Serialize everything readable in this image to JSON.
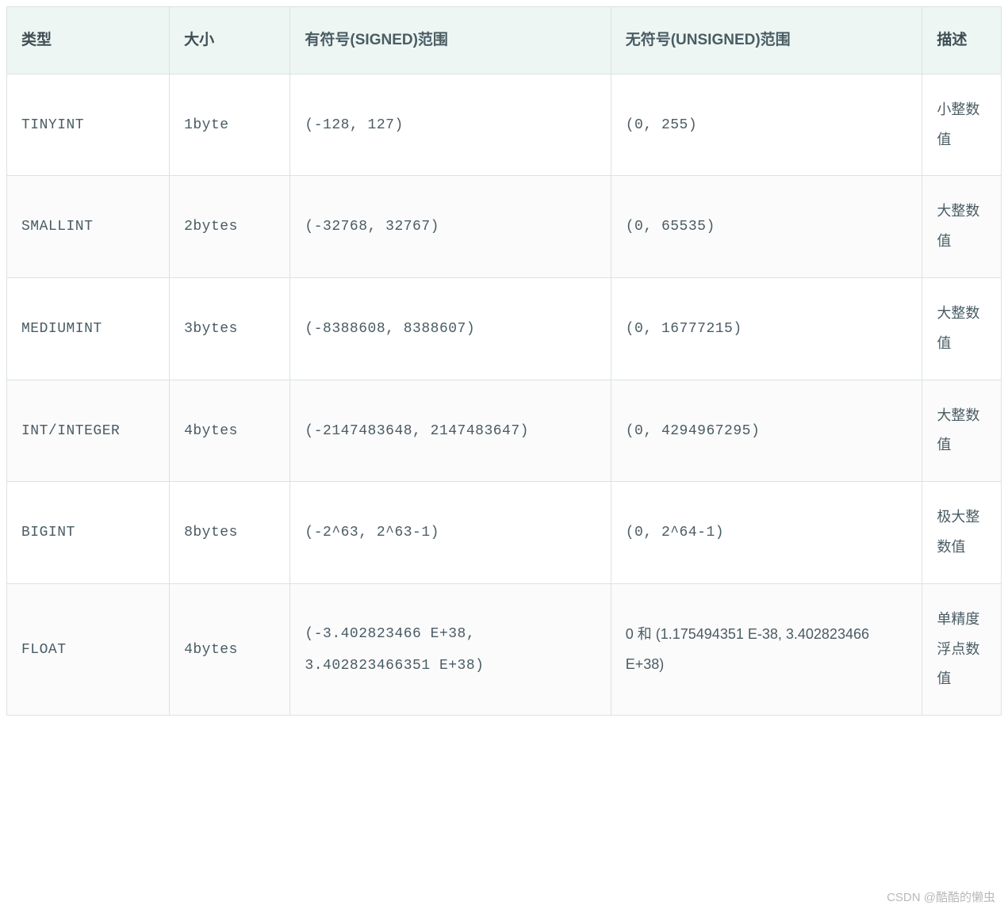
{
  "headers": {
    "type": "类型",
    "size": "大小",
    "signed": "有符号(SIGNED)范围",
    "unsigned": "无符号(UNSIGNED)范围",
    "desc": "描述"
  },
  "rows": [
    {
      "type": "TINYINT",
      "size": "1byte",
      "signed": "(-128, 127)",
      "unsigned": "(0, 255)",
      "desc": "小整数值"
    },
    {
      "type": "SMALLINT",
      "size": "2bytes",
      "signed": "(-32768, 32767)",
      "unsigned": "(0, 65535)",
      "desc": "大整数值"
    },
    {
      "type": "MEDIUMINT",
      "size": "3bytes",
      "signed": "(-8388608, 8388607)",
      "unsigned": "(0, 16777215)",
      "desc": "大整数值"
    },
    {
      "type": "INT/INTEGER",
      "size": "4bytes",
      "signed": "(-2147483648, 2147483647)",
      "unsigned": "(0, 4294967295)",
      "desc": "大整数值"
    },
    {
      "type": "BIGINT",
      "size": "8bytes",
      "signed": "(-2^63, 2^63-1)",
      "unsigned": "(0, 2^64-1)",
      "desc": "极大整数值"
    },
    {
      "type": "FLOAT",
      "size": "4bytes",
      "signed": "(-3.402823466 E+38, 3.402823466351 E+38)",
      "unsigned": "0 和 (1.175494351 E-38, 3.402823466 E+38)",
      "desc": "单精度浮点数值"
    }
  ],
  "watermark": "CSDN @酷酷的懒虫"
}
